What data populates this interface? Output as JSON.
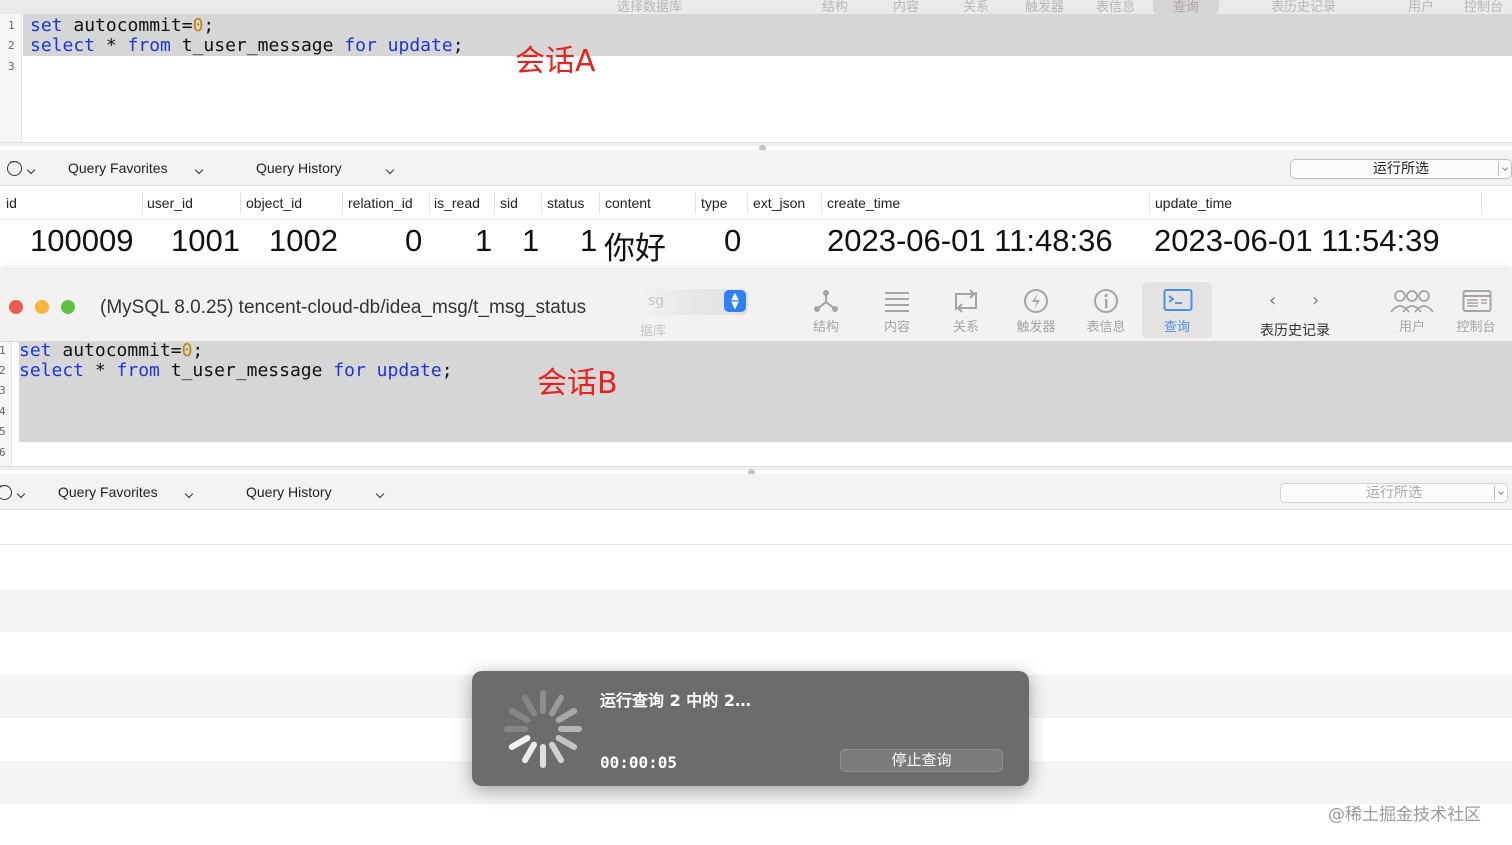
{
  "session_a": {
    "toolbar_labels": [
      "选择数据库",
      "结构",
      "内容",
      "关系",
      "触发器",
      "表信息",
      "查询",
      "表历史记录",
      "用户",
      "控制台"
    ],
    "editor": {
      "line_numbers": [
        "1",
        "2",
        "3"
      ],
      "line1": {
        "kw": "set",
        "text": " autocommit=",
        "num": "0",
        "end": ";"
      },
      "line2": {
        "kw1": "select",
        "mid1": " * ",
        "kw2": "from",
        "mid2": " t_user_message ",
        "kw3": "for",
        "sp": " ",
        "kw4": "update",
        "end": ";"
      }
    },
    "annotation": "会话A",
    "query_bar": {
      "favorites": "Query Favorites",
      "history": "Query History",
      "run_button": "运行所选"
    },
    "result": {
      "columns": [
        "id",
        "user_id",
        "object_id",
        "relation_id",
        "is_read",
        "sid",
        "status",
        "content",
        "type",
        "ext_json",
        "create_time",
        "update_time"
      ],
      "row": {
        "id": "100009",
        "user_id": "1001",
        "object_id": "1002",
        "relation_id": "0",
        "is_read": "1",
        "sid": "1",
        "status": "1",
        "content": "你好",
        "type": "0",
        "ext_json": "",
        "create_time": "2023-06-01 11:48:36",
        "update_time": "2023-06-01 11:54:39"
      }
    }
  },
  "session_b": {
    "window_title": "(MySQL 8.0.25) tencent-cloud-db/idea_msg/t_msg_status",
    "database_selector": {
      "value": "sg",
      "label": "据库"
    },
    "toolbar": [
      {
        "label": "结构",
        "icon": "structure-icon"
      },
      {
        "label": "内容",
        "icon": "content-icon"
      },
      {
        "label": "关系",
        "icon": "relations-icon"
      },
      {
        "label": "触发器",
        "icon": "triggers-icon"
      },
      {
        "label": "表信息",
        "icon": "table-info-icon"
      },
      {
        "label": "查询",
        "icon": "query-icon",
        "active": true
      }
    ],
    "history_label": "表历史记录",
    "users_label": "用户",
    "console_label": "控制台",
    "editor": {
      "line_numbers": [
        "1",
        "2",
        "3",
        "4",
        "5",
        "6"
      ],
      "line1": {
        "kw": "set",
        "text": " autocommit=",
        "num": "0",
        "end": ";"
      },
      "line2": {
        "kw1": "select",
        "mid1": " * ",
        "kw2": "from",
        "mid2": " t_user_message ",
        "kw3": "for",
        "sp": " ",
        "kw4": "update",
        "end": ";"
      }
    },
    "annotation": "会话B",
    "query_bar": {
      "favorites": "Query Favorites",
      "history": "Query History",
      "run_button": "运行所选"
    }
  },
  "progress_dialog": {
    "title": "运行查询 2 中的 2…",
    "elapsed": "00:00:05",
    "stop_button": "停止查询"
  },
  "watermark": "@稀土掘金技术社区",
  "colors": {
    "keyword": "#1a36d6",
    "number": "#b8860b",
    "annotation": "#e8221c",
    "accent": "#2f7ff5",
    "dialog_bg": "#6c6c6c"
  }
}
